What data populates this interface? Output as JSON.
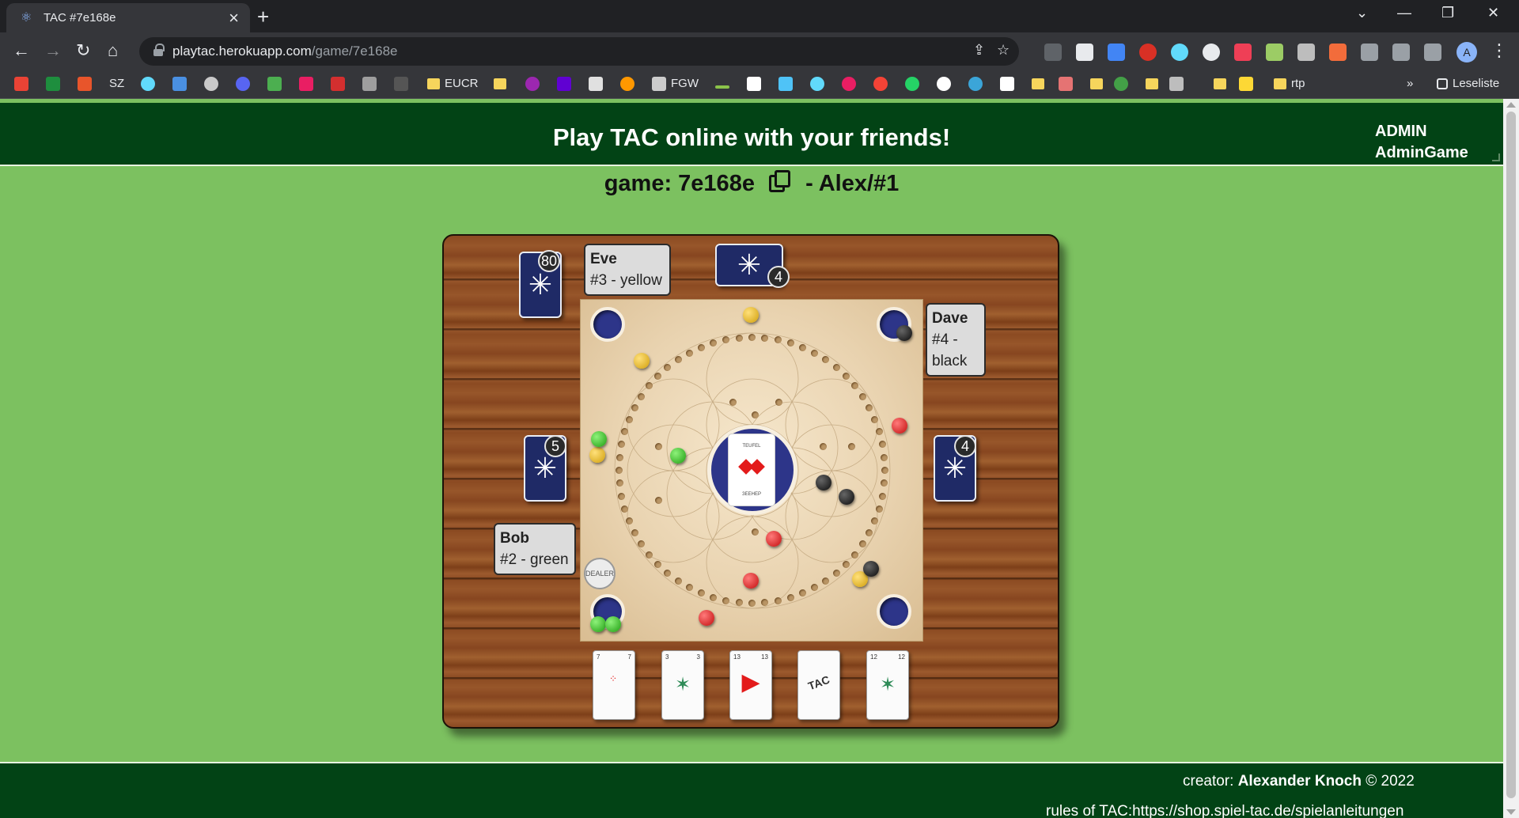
{
  "browser": {
    "tab_title": "TAC #7e168e",
    "url_host": "playtac.herokuapp.com",
    "url_path": "/game/7e168e",
    "profile_initial": "A",
    "reading_list_label": "Leseliste",
    "overflow_label": "»",
    "bookmarks": [
      {
        "label": "",
        "icon": "gmail-icon",
        "color": "#ea4335"
      },
      {
        "label": "",
        "icon": "plus-icon",
        "color": "#1e8e3e"
      },
      {
        "label": "",
        "icon": "s-icon",
        "color": "#e8552b"
      },
      {
        "label": "SZ",
        "icon": "",
        "color": ""
      },
      {
        "label": "",
        "icon": "react-icon",
        "color": "#61dafb"
      },
      {
        "label": "",
        "icon": "ao-icon",
        "color": "#4a90e2"
      },
      {
        "label": "",
        "icon": "leaf-icon",
        "color": "#c9c9c9"
      },
      {
        "label": "",
        "icon": "discord-icon",
        "color": "#5865f2"
      },
      {
        "label": "",
        "icon": "w-icon",
        "color": "#4caf50"
      },
      {
        "label": "",
        "icon": "st-icon",
        "color": "#e91e63"
      },
      {
        "label": "",
        "icon": "p-icon",
        "color": "#d32f2f"
      },
      {
        "label": "",
        "icon": "bottle-icon",
        "color": "#9e9e9e"
      },
      {
        "label": "",
        "icon": "dark-icon",
        "color": "#555555"
      },
      {
        "label": "EUCR",
        "icon": "folder",
        "color": ""
      },
      {
        "label": "",
        "icon": "folder",
        "color": ""
      },
      {
        "label": "",
        "icon": "circle-icon",
        "color": "#9c27b0"
      },
      {
        "label": "",
        "icon": "yahoo-icon",
        "color": "#6001d2"
      },
      {
        "label": "",
        "icon": "note-icon",
        "color": "#e0e0e0"
      },
      {
        "label": "",
        "icon": "s-orange-icon",
        "color": "#ff9800"
      },
      {
        "label": "FGW",
        "icon": "stripes-icon",
        "color": "#cccccc"
      }
    ],
    "bookmarks_right": [
      {
        "label": "rtp",
        "icon": "folder"
      }
    ]
  },
  "header": {
    "title": "Play TAC online with your friends!",
    "admin_line1": "ADMIN",
    "admin_line2": "AdminGame"
  },
  "game": {
    "label": "game: 7e168e",
    "player": "- Alex/#1"
  },
  "board": {
    "players": {
      "eve": {
        "name": "Eve",
        "detail": "#3 - yellow",
        "cards": "4"
      },
      "dave": {
        "name": "Dave",
        "detail_line1": "#4 -",
        "detail_line2": "black",
        "cards": "4"
      },
      "bob": {
        "name": "Bob",
        "detail": "#2 - green",
        "cards": "5"
      }
    },
    "deck_count": "80",
    "dealer_label": "DEALER",
    "center_card": {
      "top_label": "TEUFEL",
      "bottom_label": "ЗЕЕНЕР"
    },
    "hand_cards": [
      {
        "rank": "7",
        "type": "number"
      },
      {
        "rank": "3",
        "type": "number"
      },
      {
        "rank": "13",
        "type": "number"
      },
      {
        "rank": "",
        "type": "tac"
      },
      {
        "rank": "12",
        "type": "number"
      }
    ],
    "tac_label": "TAC"
  },
  "footer": {
    "credit_prefix": "creator:",
    "credit_name": "Alexander Knoch",
    "credit_suffix": "© 2022",
    "rules": "rules of TAC:https://shop.spiel-tac.de/spielanleitungen"
  },
  "colors": {
    "page_bg": "#7cc160",
    "header_bg": "#024315",
    "marble_yellow": "#e3b21c",
    "marble_green": "#2fbf1c",
    "marble_red": "#e01717",
    "marble_black": "#1a1a1a",
    "hole_blue": "#2d3589"
  }
}
